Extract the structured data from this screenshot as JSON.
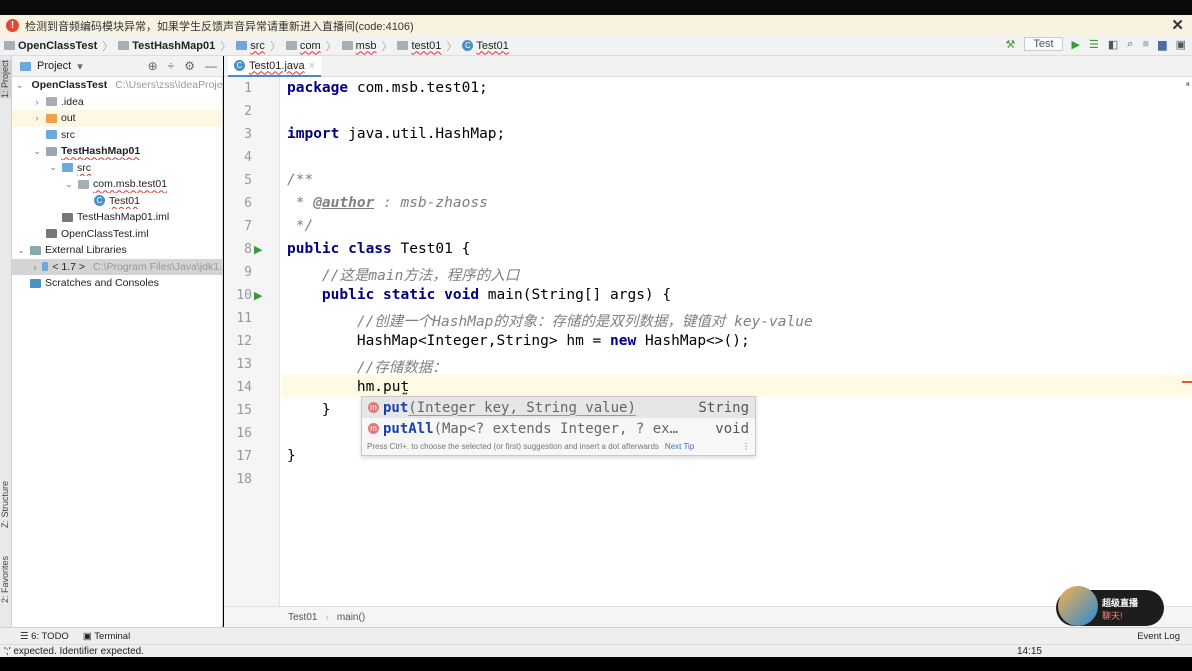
{
  "notification": {
    "text": "检测到音频编码模块异常，如果学生反馈声音异常请重新进入直播间(code:4106)",
    "close": "✕"
  },
  "navbar": {
    "crumbs": [
      "OpenClassTest",
      "TestHashMap01",
      "src",
      "com",
      "msb",
      "test01",
      "Test01"
    ]
  },
  "toolbar": {
    "run_config": "Test"
  },
  "left_stripe": {
    "project": "1: Project",
    "structure": "Z: Structure",
    "favorites": "2: Favorites"
  },
  "project_panel": {
    "title": "Project",
    "tree": [
      {
        "label": "OpenClassTest",
        "path": "C:\\Users\\zss\\IdeaProjec",
        "level": 0,
        "arrow": "v",
        "icon": "module"
      },
      {
        "label": ".idea",
        "level": 1,
        "arrow": ">",
        "icon": "folder"
      },
      {
        "label": "out",
        "level": 1,
        "arrow": ">",
        "icon": "folder-orange"
      },
      {
        "label": "src",
        "level": 1,
        "arrow": "",
        "icon": "folder-blue"
      },
      {
        "label": "TestHashMap01",
        "level": 1,
        "arrow": "v",
        "icon": "module"
      },
      {
        "label": "src",
        "level": 2,
        "arrow": "v",
        "icon": "folder-blue"
      },
      {
        "label": "com.msb.test01",
        "level": 3,
        "arrow": "v",
        "icon": "package"
      },
      {
        "label": "Test01",
        "level": 4,
        "arrow": "",
        "icon": "class"
      },
      {
        "label": "TestHashMap01.iml",
        "level": 2,
        "arrow": "",
        "icon": "iml"
      },
      {
        "label": "OpenClassTest.iml",
        "level": 1,
        "arrow": "",
        "icon": "iml"
      },
      {
        "label": "External Libraries",
        "level": 0,
        "arrow": "v",
        "icon": "library"
      },
      {
        "label": "< 1.7 >",
        "path": "C:\\Program Files\\Java\\jdk1.",
        "level": 1,
        "arrow": ">",
        "icon": "jdk"
      },
      {
        "label": "Scratches and Consoles",
        "level": 0,
        "arrow": "",
        "icon": "scratch"
      }
    ]
  },
  "editor": {
    "tab": "Test01.java",
    "lines": [
      "1",
      "2",
      "3",
      "4",
      "5",
      "6",
      "7",
      "8",
      "9",
      "10",
      "11",
      "12",
      "13",
      "14",
      "15",
      "16",
      "17",
      "18"
    ],
    "code": {
      "l1a": "package",
      "l1b": " com.msb.test01;",
      "l3a": "import",
      "l3b": " java.util.HashMap;",
      "l5": "/**",
      "l6a": " * ",
      "l6b": "@author",
      "l6c": " : msb-zhaoss",
      "l7": " */",
      "l8a": "public class",
      "l8b": " Test01 {",
      "l9": "    //这是main方法，程序的入口",
      "l10a": "    public static void",
      "l10b": " main(String[] args) {",
      "l11": "        //创建一个HashMap的对象：存储的是双列数据，键值对 key-value",
      "l12a": "        HashMap<Integer,String> hm = ",
      "l12b": "new",
      "l12c": " HashMap<>();",
      "l13": "        //存储数据：",
      "l14": "        hm.put",
      "l15": "    }",
      "l17": "}"
    },
    "breadcrumb": [
      "Test01",
      "main()"
    ]
  },
  "completion": {
    "items": [
      {
        "name": "put",
        "params": "(Integer key, String value)",
        "type": "String"
      },
      {
        "name": "putAll",
        "params": "(Map<? extends Integer, ? ex…",
        "type": "void"
      }
    ],
    "hint": "Press Ctrl+. to choose the selected (or first) suggestion and insert a dot afterwards",
    "next_tip": "Next Tip"
  },
  "tool_strip": {
    "todo": "6: TODO",
    "terminal": "Terminal",
    "event_log": "Event Log"
  },
  "status": {
    "message": "';' expected. Identifier expected.",
    "time": "14:15"
  },
  "live_widget": {
    "title": "超级直播",
    "sub": "聊天!"
  }
}
